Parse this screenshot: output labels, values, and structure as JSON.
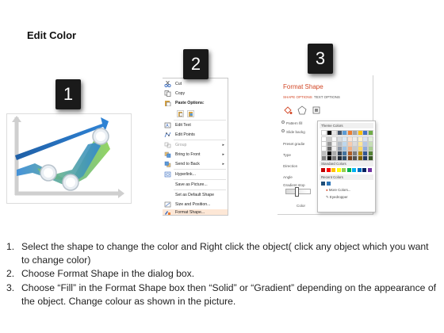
{
  "title": "Edit Color",
  "badges": [
    "1",
    "2",
    "3"
  ],
  "context_menu": {
    "items": [
      {
        "label": "Cut",
        "icon": "scissors-icon"
      },
      {
        "label": "Copy",
        "icon": "copy-icon"
      },
      {
        "label": "Paste Options:",
        "icon": "paste-icon"
      },
      {
        "label": "",
        "icon": "paste-format-icon"
      },
      {
        "label": "Edit Text",
        "icon": "edit-text-icon"
      },
      {
        "label": "Edit Points",
        "icon": "edit-points-icon"
      },
      {
        "label": "Group",
        "icon": "group-icon"
      },
      {
        "label": "Bring to Front",
        "icon": "bring-front-icon"
      },
      {
        "label": "Send to Back",
        "icon": "send-back-icon"
      },
      {
        "label": "Hyperlink...",
        "icon": "hyperlink-icon"
      },
      {
        "label": "Save as Picture...",
        "icon": ""
      },
      {
        "label": "Set as Default Shape",
        "icon": ""
      },
      {
        "label": "Size and Position...",
        "icon": "size-position-icon"
      },
      {
        "label": "Format Shape...",
        "icon": "format-shape-icon"
      }
    ]
  },
  "format_panel": {
    "title": "Format Shape",
    "tabs": [
      "SHAPE OPTIONS",
      "TEXT OPTIONS"
    ],
    "rows": [
      "Pattern fill",
      "Slide backg",
      "Preset gradie",
      "Type",
      "Direction",
      "Angle",
      "Gradient stop",
      "Color"
    ],
    "popup": {
      "theme_colors": "Theme Colors",
      "standard_colors": "Standard Colors",
      "recent_colors": "Recent Colors",
      "more_colors": "More Colors...",
      "eyedropper": "Eyedropper"
    }
  },
  "colors": {
    "theme": [
      "#ffffff",
      "#000000",
      "#e7e6e6",
      "#44546a",
      "#5b9bd5",
      "#ed7d31",
      "#a5a5a5",
      "#ffc000",
      "#4472c4",
      "#70ad47"
    ],
    "standard": [
      "#c00000",
      "#ff0000",
      "#ffc000",
      "#ffff00",
      "#92d050",
      "#00b050",
      "#00b0f0",
      "#0070c0",
      "#002060",
      "#7030a0"
    ],
    "recent": [
      "#1f4e79",
      "#2e75b6"
    ],
    "accent_orange": "#d24726"
  },
  "steps": [
    {
      "num": "1.",
      "text": "Select the shape to change the color and Right click the object( click any object which you want to change color)"
    },
    {
      "num": "2.",
      "text": "Choose Format Shape in the dialog box."
    },
    {
      "num": "3.",
      "text": "Choose “Fill” in the Format Shape box then “Solid” or “Gradient” depending on the appearance of the object. Change colour as shown in the picture."
    }
  ]
}
